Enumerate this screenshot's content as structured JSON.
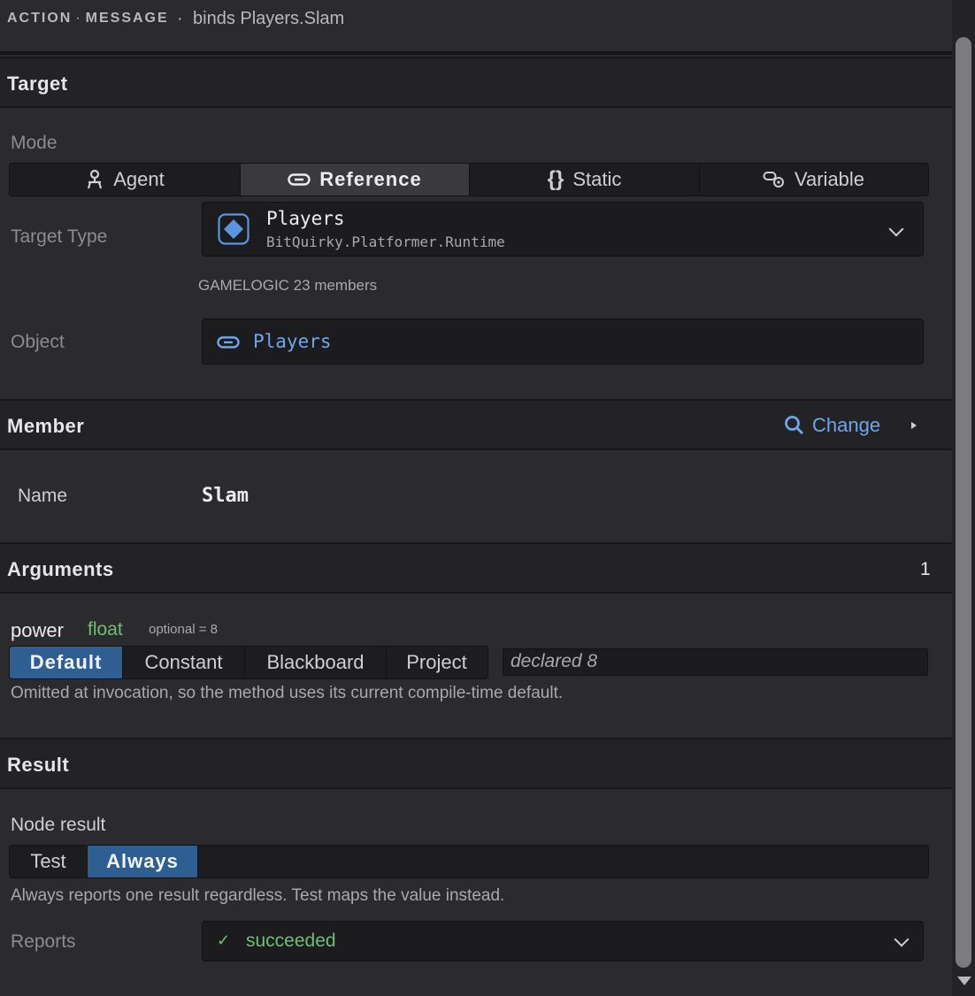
{
  "header": {
    "crumb_action": "ACTION",
    "crumb_message": "MESSAGE",
    "binds": "binds Players.Slam"
  },
  "target": {
    "title": "Target",
    "mode_label": "Mode",
    "modes": [
      "Agent",
      "Reference",
      "Static",
      "Variable"
    ],
    "selected_mode": "Reference",
    "type_label": "Target Type",
    "type_name": "Players",
    "type_namespace": "BitQuirky.Platformer.Runtime",
    "type_info": "GAMELOGIC 23 members",
    "object_label": "Object",
    "object_value": "Players"
  },
  "member": {
    "title": "Member",
    "change_label": "Change",
    "name_label": "Name",
    "name_value": "Slam"
  },
  "arguments": {
    "title": "Arguments",
    "count": "1",
    "param_name": "power",
    "param_type": "float",
    "param_default": "optional = 8",
    "sources": [
      "Default",
      "Constant",
      "Blackboard",
      "Project"
    ],
    "selected_source": "Default",
    "value_placeholder": "declared 8",
    "help": "Omitted at invocation, so the method uses its current compile-time default."
  },
  "result": {
    "title": "Result",
    "node_result_label": "Node result",
    "options": [
      "Test",
      "Always"
    ],
    "selected": "Always",
    "help": "Always reports one result regardless. Test maps the value instead.",
    "reports_label": "Reports",
    "reports_value": "succeeded"
  },
  "colors": {
    "accent": "#2f5e93",
    "link": "#6fa6ea",
    "type_green": "#6cc070",
    "success": "#6cc070"
  }
}
